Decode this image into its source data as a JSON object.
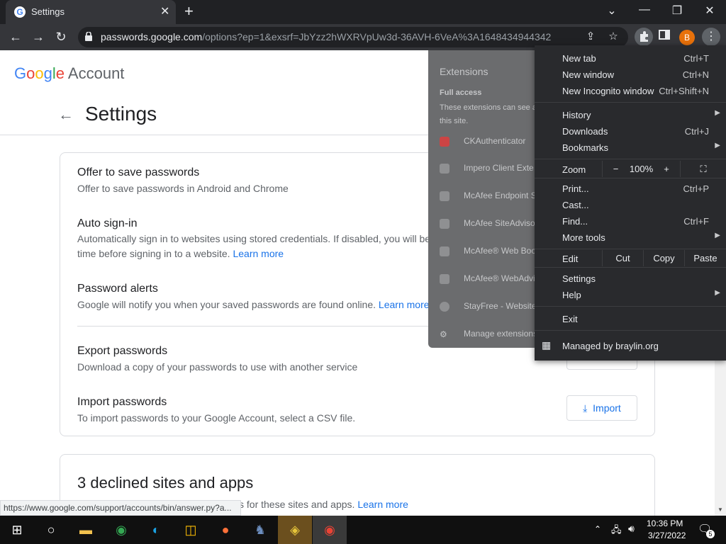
{
  "browser": {
    "tab_title": "Settings",
    "tab_favicon": "G",
    "new_tab_symbol": "+",
    "url_host": "passwords.google.com",
    "url_rest": "/options?ep=1&exsrf=JbYzz2hWXRVpUw3d-36AVH-6VeA%3A1648434944342",
    "profile_initial": "B"
  },
  "header": {
    "logo_letters": [
      "G",
      "o",
      "o",
      "g",
      "l",
      "e"
    ],
    "logo_suffix": "Account",
    "page_title": "Settings"
  },
  "options": {
    "offer_title": "Offer to save passwords",
    "offer_desc": "Offer to save passwords in Android and Chrome",
    "autosignin_title": "Auto sign-in",
    "autosignin_desc1": "Automatically sign in to websites using stored credentials. If disabled, you will be asked for confirmat",
    "autosignin_desc2": "time before signing in to a website.",
    "learn_more": "Learn more",
    "alerts_title": "Password alerts",
    "alerts_desc": "Google will notify you when your saved passwords are found online.",
    "export_title": "Export passwords",
    "export_desc": "Download a copy of your passwords to use with another service",
    "import_title": "Import passwords",
    "import_desc": "To import passwords to your Google Account, select a CSV file.",
    "import_button": "Import"
  },
  "declined": {
    "title": "3 declined sites and apps",
    "desc_visible": "s for these sites and apps.",
    "learn_more": "Learn more"
  },
  "status_url": "https://www.google.com/support/accounts/bin/answer.py?a...",
  "extensions_popup": {
    "title": "Extensions",
    "full_access": "Full access",
    "note_line1": "These extensions can see a",
    "note_line2": "this site.",
    "items": [
      {
        "label": "CKAuthenticator",
        "icon": "ck-icon"
      },
      {
        "label": "Impero Client Exte",
        "icon": "impero-icon"
      },
      {
        "label": "McAfee Endpoint S",
        "icon": "mcafee-icon"
      },
      {
        "label": "McAfee SiteAdvisor",
        "icon": "mcafee-icon"
      },
      {
        "label": "McAfee® Web Boo",
        "icon": "mcafee-icon"
      },
      {
        "label": "McAfee® WebAdvi",
        "icon": "mcafee-icon"
      },
      {
        "label": "StayFree - Website",
        "icon": "stayfree-icon"
      }
    ],
    "manage": "Manage extensions"
  },
  "menu": {
    "new_tab": "New tab",
    "new_tab_sc": "Ctrl+T",
    "new_window": "New window",
    "new_window_sc": "Ctrl+N",
    "incognito": "New Incognito window",
    "incognito_sc": "Ctrl+Shift+N",
    "history": "History",
    "downloads": "Downloads",
    "downloads_sc": "Ctrl+J",
    "bookmarks": "Bookmarks",
    "zoom": "Zoom",
    "zoom_minus": "−",
    "zoom_value": "100%",
    "zoom_plus": "+",
    "print": "Print...",
    "print_sc": "Ctrl+P",
    "cast": "Cast...",
    "find": "Find...",
    "find_sc": "Ctrl+F",
    "more_tools": "More tools",
    "edit": "Edit",
    "cut": "Cut",
    "copy": "Copy",
    "paste": "Paste",
    "settings": "Settings",
    "help": "Help",
    "exit": "Exit",
    "managed": "Managed by braylin.org"
  },
  "taskbar": {
    "time": "10:36 PM",
    "date": "3/27/2022",
    "notification_count": "5"
  }
}
